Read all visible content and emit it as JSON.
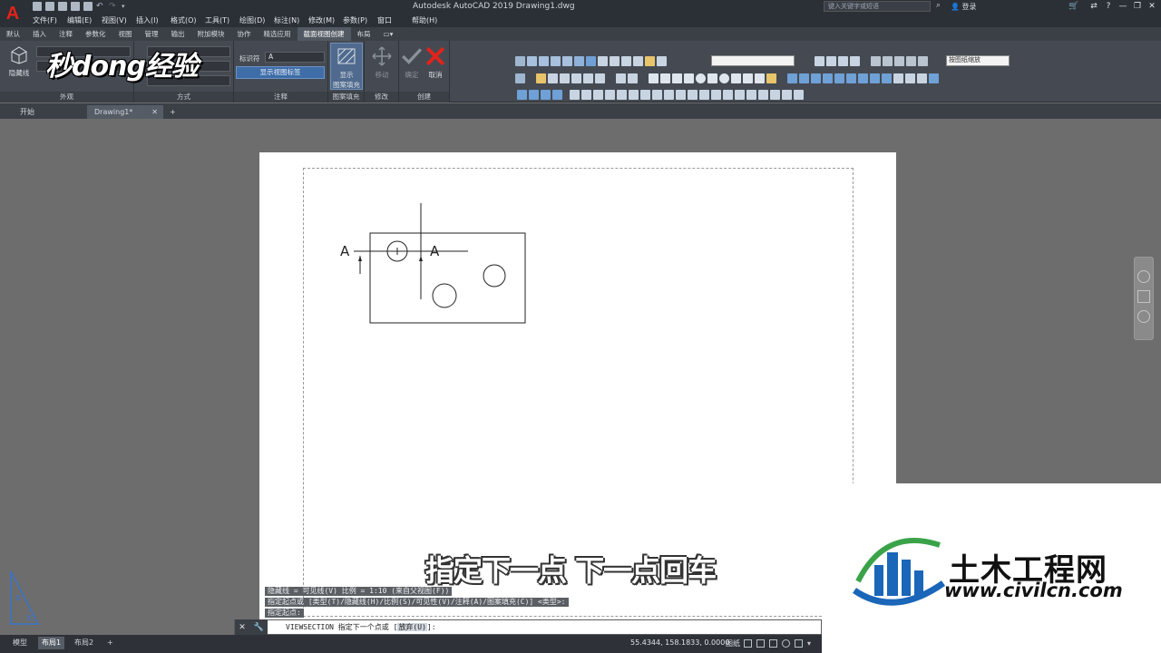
{
  "titlebar": {
    "app_letter": "A",
    "title": "Autodesk AutoCAD 2019    Drawing1.dwg",
    "search_placeholder": "键入关键字或短语",
    "login": "登录"
  },
  "menu": [
    "文件(F)",
    "编辑(E)",
    "视图(V)",
    "插入(I)",
    "格式(O)",
    "工具(T)",
    "绘图(D)",
    "标注(N)",
    "修改(M)",
    "参数(P)",
    "窗口(W)",
    "帮助(H)"
  ],
  "ribbon_tabs": [
    "默认",
    "插入",
    "注释",
    "参数化",
    "视图",
    "管理",
    "输出",
    "附加模块",
    "协作",
    "精选应用",
    "截面视图创建",
    "布局"
  ],
  "ribbon_active_tab": "截面视图创建",
  "ribbon": {
    "hidden_line_label": "隐藏线",
    "panel_appearance": "外观",
    "panel_method": "方式",
    "panel_annotation": "注释",
    "identifier_label": "标识符",
    "identifier_value": "A",
    "show_view_label": "显示视图标签",
    "panel_hatch": "图案填充",
    "show_hatch_line1": "显示",
    "show_hatch_line2": "图案填充",
    "panel_modify": "修改",
    "move_label": "移动",
    "panel_create": "创建",
    "done_label": "确定",
    "cancel_label": "取消",
    "scale_dropdown": "按图纸缩放"
  },
  "watermark": "秒dong经验",
  "file_tabs": [
    "开始",
    "Drawing1*"
  ],
  "drawing": {
    "section_label_left": "A",
    "section_label_right": "A"
  },
  "command": {
    "history1": "隐藏线 = 可见线(V)  比例 = 1:10 (来自父视图(F))",
    "history2": "指定起点或 [类型(T)/隐藏线(H)/比例(S)/可见性(V)/注释(A)/图案填充(C)] <类型>:",
    "history3": "指定起点:",
    "prompt_prefix": "VIEWSECTION 指定下一个点或 [",
    "prompt_option": "放弃(U)",
    "prompt_suffix": "]:"
  },
  "subtitle": "指定下一点 下一点回车",
  "brand": {
    "title": "土木工程网",
    "url": "www.civilcn.com"
  },
  "status": {
    "tabs": [
      "模型",
      "布局1",
      "布局2"
    ],
    "active_tab": "布局1",
    "coords": "55.4344, 158.1833, 0.0000",
    "space": "图纸"
  },
  "colors": {
    "accent_red": "#e2231a",
    "ribbon_bg": "#454a52",
    "brand_blue": "#1a66b8",
    "brand_green": "#3aa34a"
  }
}
